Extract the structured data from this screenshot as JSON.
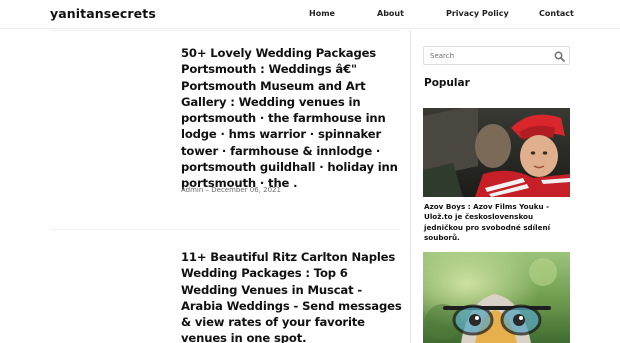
{
  "site": {
    "brand": "yanitansecrets"
  },
  "nav": {
    "items": [
      "Home",
      "About",
      "Privacy Policy",
      "Contact"
    ]
  },
  "posts": [
    {
      "title": "50+ Lovely Wedding Packages Portsmouth : Weddings â€\" Portsmouth Museum and Art Gallery : Wedding venues in portsmouth · the farmhouse inn lodge · hms warrior · spinnaker tower · farmhouse & innlodge · portsmouth guildhall · holiday inn portsmouth · the .",
      "meta": "Admin – December 06, 2021"
    },
    {
      "title": "11+ Beautiful Ritz Carlton Naples Wedding Packages : Top 6 Wedding Venues in Muscat - Arabia Weddings - Send messages & view rates of your favorite venues in one spot."
    }
  ],
  "sidebar": {
    "search": {
      "placeholder": "Search",
      "icon": "search-icon"
    },
    "popular_heading": "Popular",
    "popular_items": [
      {
        "caption": "Azov Boys : Azov Films Youku - Ulož.to je československou jedničkou pro svobodné sdílení souborů."
      }
    ]
  },
  "colors": {
    "text": "#111111",
    "meta_text": "#6b6b6b",
    "divider": "#e6e6e6",
    "background": "#ffffff"
  }
}
